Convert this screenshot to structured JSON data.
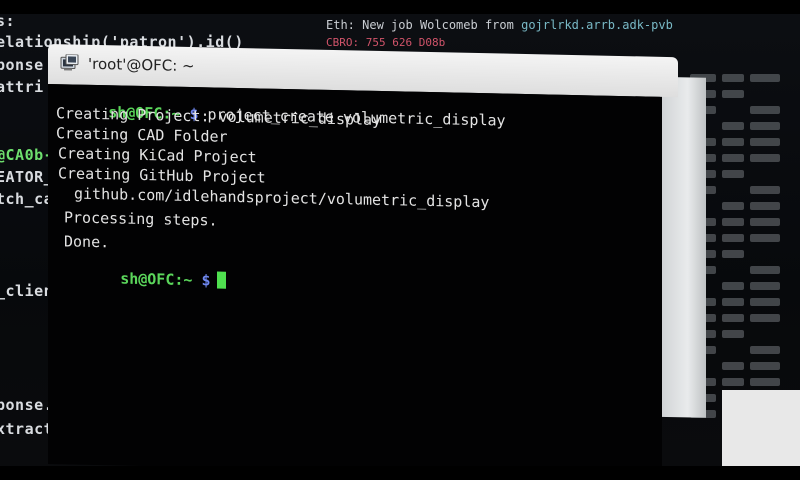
{
  "background": {
    "left_code": [
      "s:",
      "elationship('patron').id()",
      "ponse",
      "attri",
      "@CA0b-",
      "EATOR_",
      "tch_ca",
      "_client",
      "ponse.da",
      "xtract_c"
    ],
    "top_log": {
      "line1_prefix": "Eth:",
      "line1_text": "New job Wolcomeb from ",
      "line1_path": "gojrlrkd.arrb.adk-pvb",
      "line2": "CBRO: 755 626 D08b"
    }
  },
  "window": {
    "title": "'root'@OFC: ~",
    "icon": "terminal-icon"
  },
  "terminal": {
    "prompt_user": "sh@OFC:~",
    "prompt_symbol": "$",
    "command": "project_create volumetric_display",
    "output": [
      "Creating Project: volumetric_display",
      "Creating CAD Folder",
      "Creating KiCad Project",
      "Creating GitHub Project",
      "github.com/idlehandsproject/volumetric_display",
      "Processing steps.",
      "Done."
    ]
  },
  "colors": {
    "prompt_green": "#5bd65b",
    "prompt_blue": "#6f88f0",
    "cursor_green": "#4fe04f",
    "text": "#e3e3e3",
    "terminal_bg": "#020203"
  }
}
